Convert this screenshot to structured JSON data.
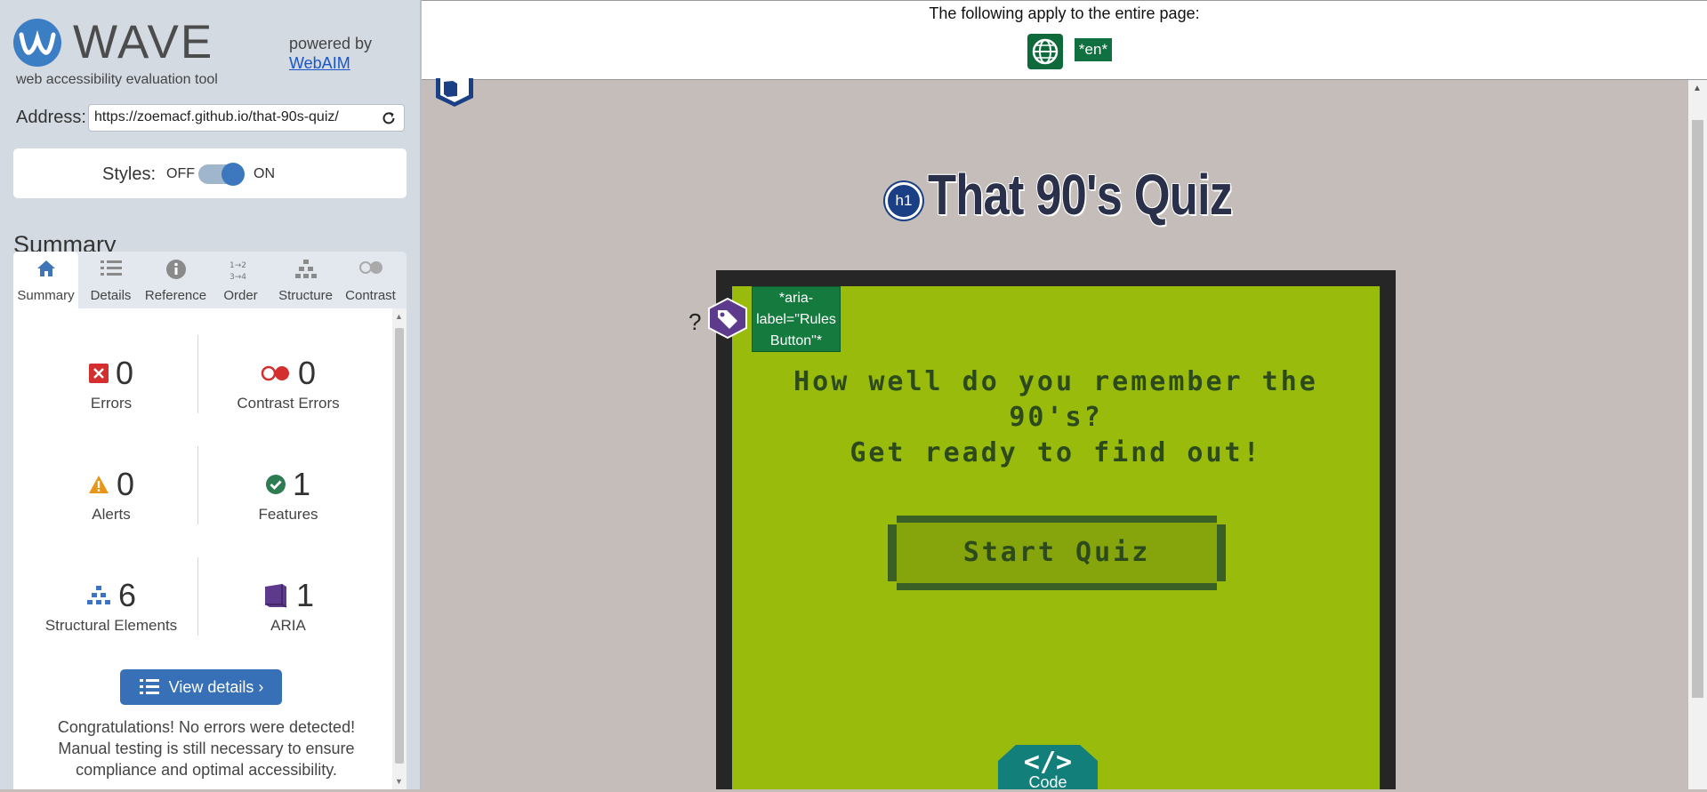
{
  "wave": {
    "logo_title": "WAVE",
    "logo_subtitle": "web accessibility evaluation tool",
    "powered_by": "powered by",
    "webaim_link": "WebAIM"
  },
  "address": {
    "label": "Address:",
    "value": "https://zoemacf.github.io/that-90s-quiz/"
  },
  "styles": {
    "label": "Styles:",
    "off": "OFF",
    "on": "ON",
    "state": "on"
  },
  "summary": {
    "heading": "Summary",
    "tabs": [
      {
        "label": "Summary",
        "icon": "home-icon",
        "active": true
      },
      {
        "label": "Details",
        "icon": "list-icon",
        "active": false
      },
      {
        "label": "Reference",
        "icon": "info-icon",
        "active": false
      },
      {
        "label": "Order",
        "icon": "order-icon",
        "active": false
      },
      {
        "label": "Structure",
        "icon": "structure-icon",
        "active": false
      },
      {
        "label": "Contrast",
        "icon": "contrast-icon",
        "active": false
      }
    ],
    "stats": [
      {
        "label": "Errors",
        "count": "0",
        "icon": "error-icon",
        "color": "#d32f2f"
      },
      {
        "label": "Contrast Errors",
        "count": "0",
        "icon": "contrast-error-icon",
        "color": "#d32f2f"
      },
      {
        "label": "Alerts",
        "count": "0",
        "icon": "alert-icon",
        "color": "#e8961a"
      },
      {
        "label": "Features",
        "count": "1",
        "icon": "feature-icon",
        "color": "#2e7d52"
      },
      {
        "label": "Structural Elements",
        "count": "6",
        "icon": "structure-element-icon",
        "color": "#3b74c4"
      },
      {
        "label": "ARIA",
        "count": "1",
        "icon": "aria-icon",
        "color": "#5e3a8c"
      }
    ],
    "view_details": "View details ›",
    "congrats": "Congratulations! No errors were detected! Manual testing is still necessary to ensure compliance and optimal accessibility."
  },
  "page": {
    "topbar_text": "The following apply to the entire page:",
    "lang_badge": "*en*",
    "h1_badge": "h1",
    "title": "That 90's Quiz",
    "question_line1": "How well do you remember the",
    "question_line2": "90's?",
    "question_line3": "Get ready to find out!",
    "start_button": "Start Quiz",
    "rules_question_mark": "?",
    "aria_label_line1": "*aria-",
    "aria_label_line2": "label=\"Rules",
    "aria_label_line3": "Button\"*",
    "code_label": "Code",
    "code_glyph": "</>"
  }
}
